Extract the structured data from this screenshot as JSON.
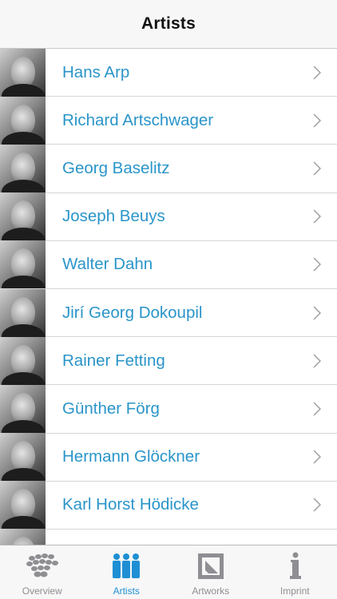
{
  "navbar": {
    "title": "Artists"
  },
  "artists": [
    {
      "name": "Hans Arp"
    },
    {
      "name": "Richard Artschwager"
    },
    {
      "name": "Georg Baselitz"
    },
    {
      "name": "Joseph Beuys"
    },
    {
      "name": "Walter Dahn"
    },
    {
      "name": "Jirí Georg Dokoupil"
    },
    {
      "name": "Rainer Fetting"
    },
    {
      "name": "Günther Förg"
    },
    {
      "name": "Hermann Glöckner"
    },
    {
      "name": "Karl Horst Hödicke"
    },
    {
      "name": ""
    }
  ],
  "tabs": [
    {
      "label": "Overview",
      "icon": "overview-icon",
      "active": false
    },
    {
      "label": "Artists",
      "icon": "artists-icon",
      "active": true
    },
    {
      "label": "Artworks",
      "icon": "artworks-icon",
      "active": false
    },
    {
      "label": "Imprint",
      "icon": "imprint-icon",
      "active": false
    }
  ],
  "colors": {
    "accent": "#1f8fd4",
    "link": "#2a95c9",
    "tab_inactive": "#8e8e93"
  }
}
